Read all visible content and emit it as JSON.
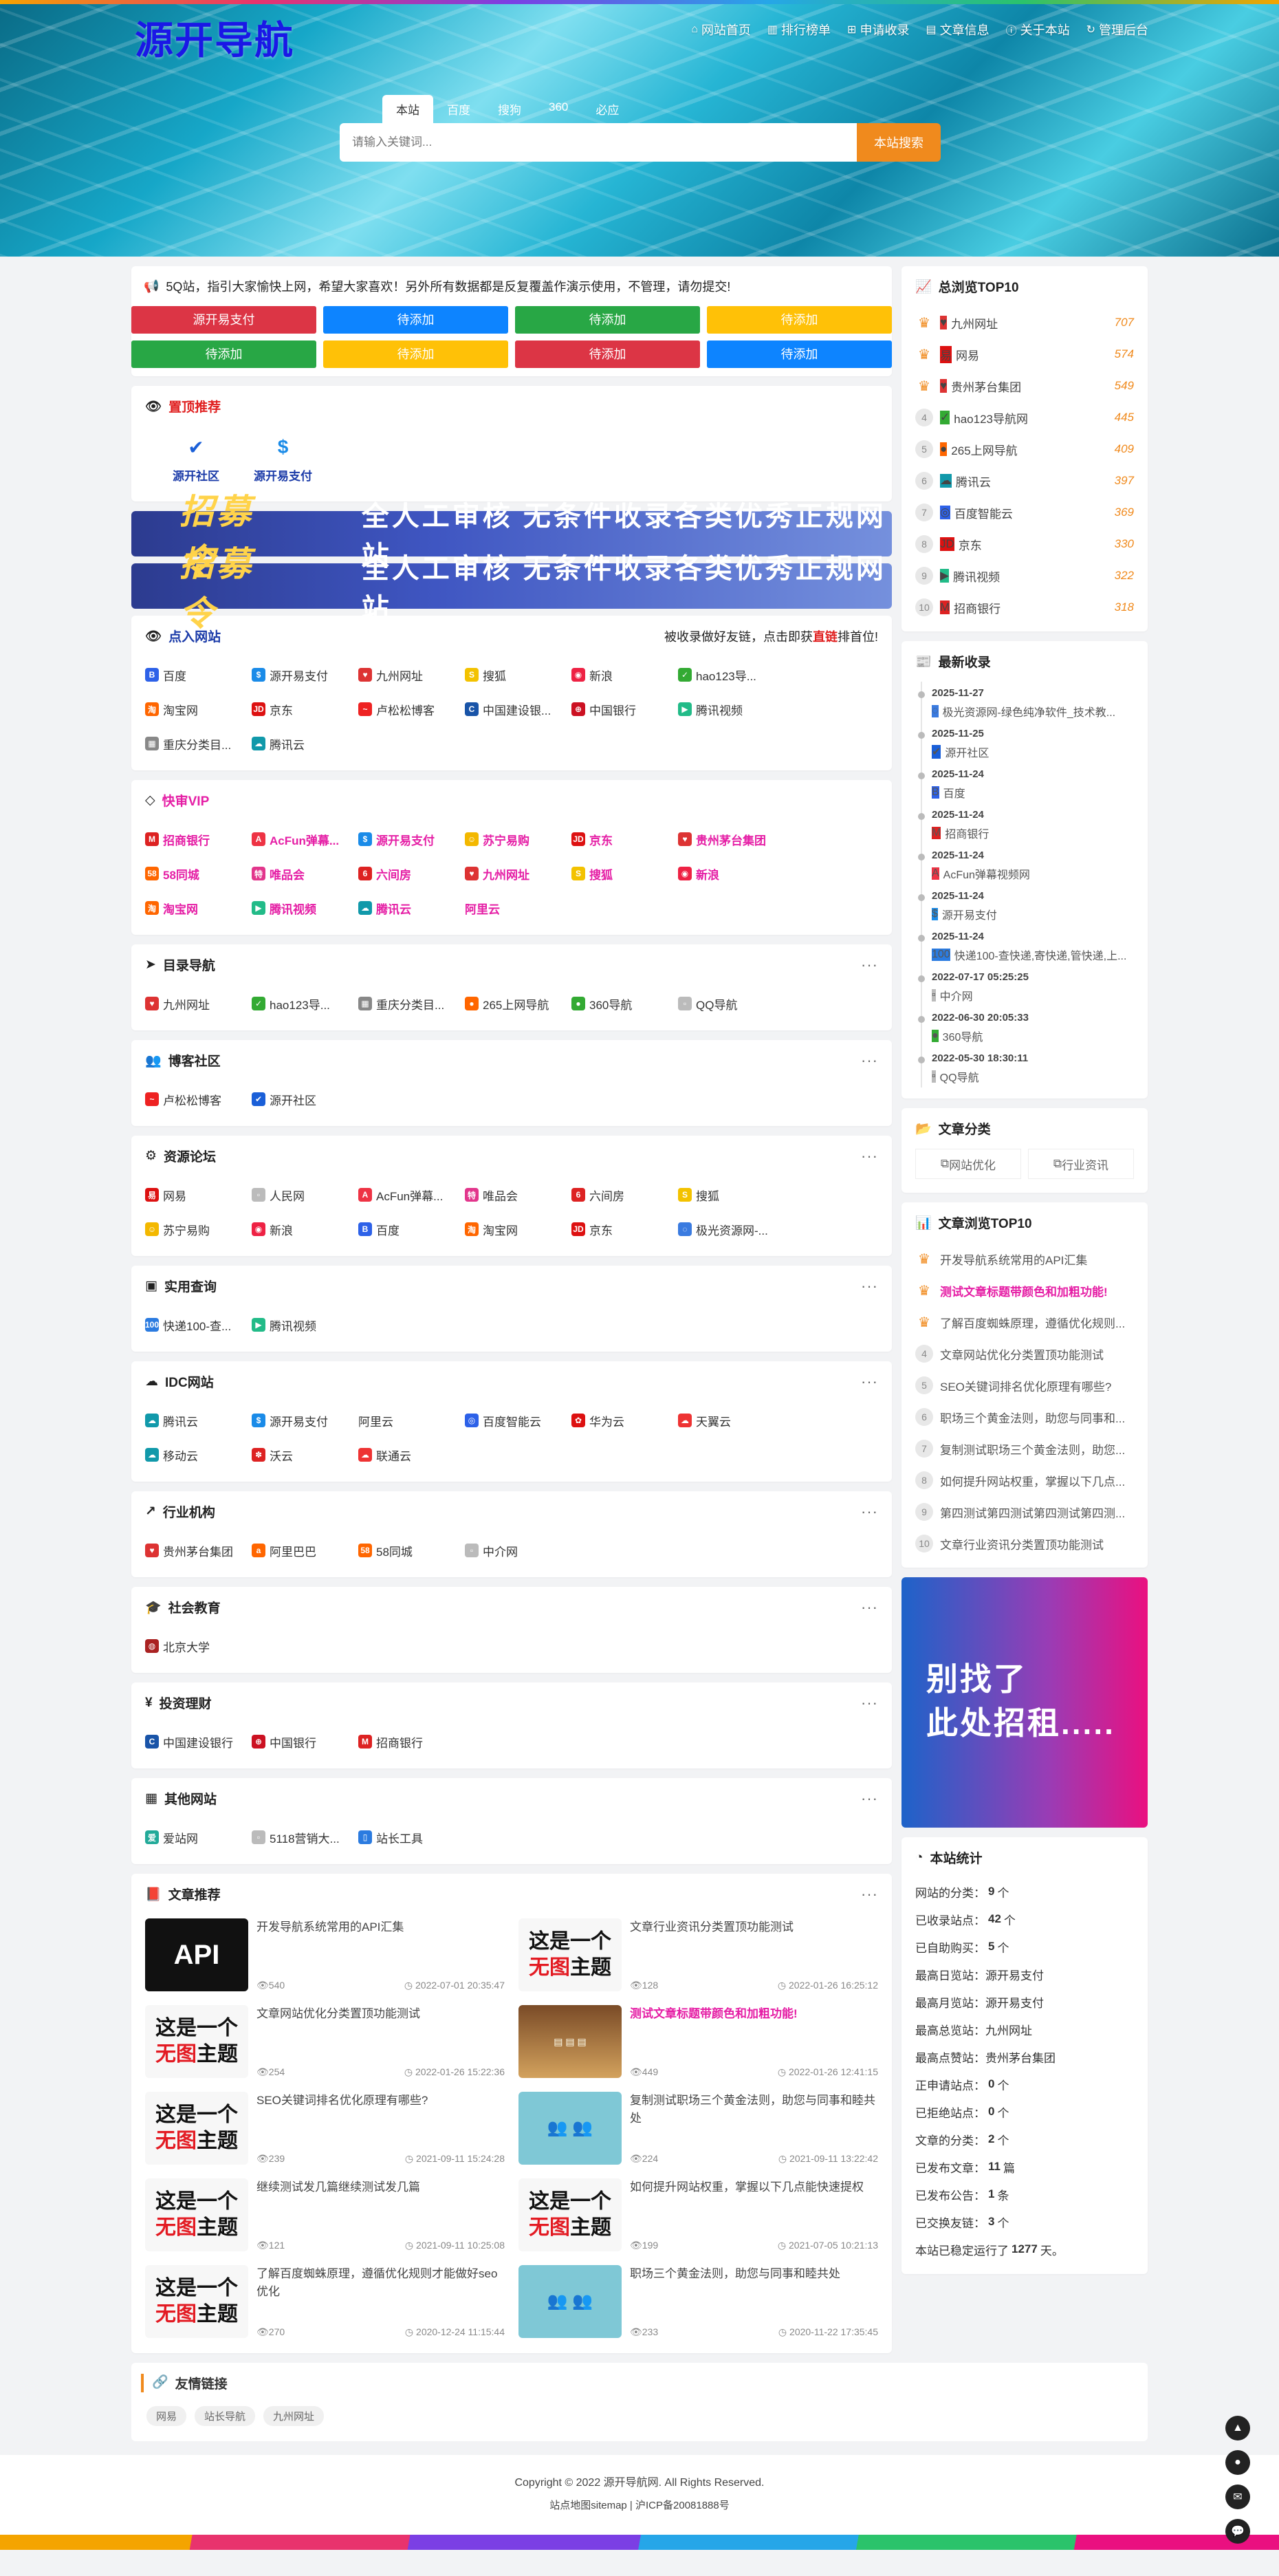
{
  "site": {
    "logo": "源开导航",
    "nav": [
      {
        "icon": "home-icon",
        "glyph": "⌂",
        "label": "网站首页"
      },
      {
        "icon": "chart-icon",
        "glyph": "▥",
        "label": "排行榜单"
      },
      {
        "icon": "plus-icon",
        "glyph": "⊞",
        "label": "申请收录"
      },
      {
        "icon": "document-icon",
        "glyph": "▤",
        "label": "文章信息"
      },
      {
        "icon": "info-icon",
        "glyph": "ⓘ",
        "label": "关于本站"
      },
      {
        "icon": "refresh-icon",
        "glyph": "↻",
        "label": "管理后台"
      }
    ]
  },
  "search": {
    "tabs": [
      "本站",
      "百度",
      "搜狗",
      "360",
      "必应"
    ],
    "placeholder": "请输入关键词...",
    "button": "本站搜索"
  },
  "notice": "5Q站，指引大家愉快上网，希望大家喜欢！另外所有数据都是反复覆盖作演示使用，不管理，请勿提交!",
  "quick_buttons": [
    {
      "label": "源开易支付",
      "color": "red"
    },
    {
      "label": "待添加",
      "color": "blue"
    },
    {
      "label": "待添加",
      "color": "green"
    },
    {
      "label": "待添加",
      "color": "yellow"
    },
    {
      "label": "待添加",
      "color": "green"
    },
    {
      "label": "待添加",
      "color": "yellow"
    },
    {
      "label": "待添加",
      "color": "red"
    },
    {
      "label": "待添加",
      "color": "blue"
    }
  ],
  "top_recommend": {
    "title": "置顶推荐",
    "items": [
      {
        "label": "源开社区",
        "glyph": "✔",
        "color": "#1a5fd8"
      },
      {
        "label": "源开易支付",
        "glyph": "$",
        "color": "#1a8be8"
      }
    ]
  },
  "banners": [
    {
      "tag": "招募令",
      "text": "全人工审核  无条件收录各类优秀正规网站"
    },
    {
      "tag": "招募令",
      "text": "全人工审核  无条件收录各类优秀正规网站"
    }
  ],
  "clicked": {
    "title": "点入网站",
    "note_pre": "被收录做好友链，点击即获",
    "note_hl": "直链",
    "note_post": "排首位!",
    "sites": [
      {
        "n": "百度",
        "g": "B",
        "c": "#2d61e8"
      },
      {
        "n": "源开易支付",
        "g": "$",
        "c": "#1a8be8"
      },
      {
        "n": "九州网址",
        "g": "♥",
        "c": "#d33"
      },
      {
        "n": "搜狐",
        "g": "S",
        "c": "#f3c200"
      },
      {
        "n": "新浪",
        "g": "◉",
        "c": "#e24"
      },
      {
        "n": "hao123导...",
        "g": "✓",
        "c": "#3a3"
      },
      {
        "n": "淘宝网",
        "g": "淘",
        "c": "#f60"
      },
      {
        "n": "京东",
        "g": "JD",
        "c": "#d11"
      },
      {
        "n": "卢松松博客",
        "g": "~",
        "c": "#e22"
      },
      {
        "n": "中国建设银...",
        "g": "C",
        "c": "#1954a8"
      },
      {
        "n": "中国银行",
        "g": "⊕",
        "c": "#c12"
      },
      {
        "n": "腾讯视频",
        "g": "▶",
        "c": "#2b8"
      },
      {
        "n": "重庆分类目...",
        "g": "▦",
        "c": "#888"
      },
      {
        "n": "腾讯云",
        "g": "☁",
        "c": "#19a"
      }
    ]
  },
  "vip": {
    "title": "快审VIP",
    "sites": [
      {
        "n": "招商银行",
        "g": "M",
        "c": "#d22"
      },
      {
        "n": "AcFun弹幕...",
        "g": "A",
        "c": "#e34"
      },
      {
        "n": "源开易支付",
        "g": "$",
        "c": "#1a8be8"
      },
      {
        "n": "苏宁易购",
        "g": "☺",
        "c": "#f3b800"
      },
      {
        "n": "京东",
        "g": "JD",
        "c": "#d11"
      },
      {
        "n": "贵州茅台集团",
        "g": "♥",
        "c": "#d33"
      },
      {
        "n": "58同城",
        "g": "58",
        "c": "#f60"
      },
      {
        "n": "唯品会",
        "g": "特",
        "c": "#e2368c"
      },
      {
        "n": "六间房",
        "g": "6",
        "c": "#d22"
      },
      {
        "n": "九州网址",
        "g": "♥",
        "c": "#d33"
      },
      {
        "n": "搜狐",
        "g": "S",
        "c": "#f3c200"
      },
      {
        "n": "新浪",
        "g": "◉",
        "c": "#e24"
      },
      {
        "n": "淘宝网",
        "g": "淘",
        "c": "#f60"
      },
      {
        "n": "腾讯视频",
        "g": "▶",
        "c": "#2b8"
      },
      {
        "n": "腾讯云",
        "g": "☁",
        "c": "#19a"
      },
      {
        "n": "阿里云",
        "g": "",
        "c": "#ffffff"
      }
    ]
  },
  "categories": [
    {
      "title": "目录导航",
      "icon": "send-icon",
      "glyph": "➤",
      "sites": [
        {
          "n": "九州网址",
          "g": "♥",
          "c": "#d33"
        },
        {
          "n": "hao123导...",
          "g": "✓",
          "c": "#3a3"
        },
        {
          "n": "重庆分类目...",
          "g": "▦",
          "c": "#888"
        },
        {
          "n": "265上网导航",
          "g": "●",
          "c": "#f60"
        },
        {
          "n": "360导航",
          "g": "●",
          "c": "#3a3"
        },
        {
          "n": "QQ导航",
          "g": "▫",
          "c": "#bbb"
        }
      ]
    },
    {
      "title": "博客社区",
      "icon": "users-icon",
      "glyph": "👥",
      "sites": [
        {
          "n": "卢松松博客",
          "g": "~",
          "c": "#e22"
        },
        {
          "n": "源开社区",
          "g": "✔",
          "c": "#1a5fd8"
        }
      ]
    },
    {
      "title": "资源论坛",
      "icon": "forum-icon",
      "glyph": "⚙",
      "sites": [
        {
          "n": "网易",
          "g": "易",
          "c": "#d11"
        },
        {
          "n": "人民网",
          "g": "▫",
          "c": "#bbb"
        },
        {
          "n": "AcFun弹幕...",
          "g": "A",
          "c": "#e34"
        },
        {
          "n": "唯品会",
          "g": "特",
          "c": "#e2368c"
        },
        {
          "n": "六间房",
          "g": "6",
          "c": "#d22"
        },
        {
          "n": "搜狐",
          "g": "S",
          "c": "#f3c200"
        },
        {
          "n": "苏宁易购",
          "g": "☺",
          "c": "#f3b800"
        },
        {
          "n": "新浪",
          "g": "◉",
          "c": "#e24"
        },
        {
          "n": "百度",
          "g": "B",
          "c": "#2d61e8"
        },
        {
          "n": "淘宝网",
          "g": "淘",
          "c": "#f60"
        },
        {
          "n": "京东",
          "g": "JD",
          "c": "#d11"
        },
        {
          "n": "极光资源网-...",
          "g": "◌",
          "c": "#3a7be0"
        }
      ]
    },
    {
      "title": "实用查询",
      "icon": "video-icon",
      "glyph": "▣",
      "sites": [
        {
          "n": "快递100-查...",
          "g": "100",
          "c": "#2b7be0"
        },
        {
          "n": "腾讯视频",
          "g": "▶",
          "c": "#2b8"
        }
      ]
    },
    {
      "title": "IDC网站",
      "icon": "cloud-icon",
      "glyph": "☁",
      "sites": [
        {
          "n": "腾讯云",
          "g": "☁",
          "c": "#19a"
        },
        {
          "n": "源开易支付",
          "g": "$",
          "c": "#1a8be8"
        },
        {
          "n": "阿里云",
          "g": "",
          "c": "#ffffff"
        },
        {
          "n": "百度智能云",
          "g": "◎",
          "c": "#2d61e8"
        },
        {
          "n": "华为云",
          "g": "✿",
          "c": "#d11"
        },
        {
          "n": "天翼云",
          "g": "☁",
          "c": "#e33"
        },
        {
          "n": "移动云",
          "g": "☁",
          "c": "#19a"
        },
        {
          "n": "沃云",
          "g": "✽",
          "c": "#d22"
        },
        {
          "n": "联通云",
          "g": "☁",
          "c": "#e33"
        }
      ]
    },
    {
      "title": "行业机构",
      "icon": "trend-icon",
      "glyph": "↗",
      "sites": [
        {
          "n": "贵州茅台集团",
          "g": "♥",
          "c": "#d33"
        },
        {
          "n": "阿里巴巴",
          "g": "a",
          "c": "#f60"
        },
        {
          "n": "58同城",
          "g": "58",
          "c": "#f60"
        },
        {
          "n": "中介网",
          "g": "▫",
          "c": "#bbb"
        }
      ]
    },
    {
      "title": "社会教育",
      "icon": "graduation-icon",
      "glyph": "🎓",
      "sites": [
        {
          "n": "北京大学",
          "g": "◍",
          "c": "#a22"
        }
      ]
    },
    {
      "title": "投资理财",
      "icon": "yen-icon",
      "glyph": "¥",
      "sites": [
        {
          "n": "中国建设银行",
          "g": "C",
          "c": "#1954a8"
        },
        {
          "n": "中国银行",
          "g": "⊕",
          "c": "#c12"
        },
        {
          "n": "招商银行",
          "g": "M",
          "c": "#d22"
        }
      ]
    },
    {
      "title": "其他网站",
      "icon": "grid-icon",
      "glyph": "▦",
      "sites": [
        {
          "n": "爱站网",
          "g": "爱",
          "c": "#2a9"
        },
        {
          "n": "5118营销大...",
          "g": "▫",
          "c": "#bbb"
        },
        {
          "n": "站长工具",
          "g": "▯",
          "c": "#2b7be0"
        }
      ]
    }
  ],
  "articles": {
    "title": "文章推荐",
    "items": [
      {
        "title": "开发导航系统常用的API汇集",
        "views": "540",
        "date": "2022-07-01 20:35:47",
        "thumb": "api",
        "hl": false
      },
      {
        "title": "文章行业资讯分类置顶功能测试",
        "views": "128",
        "date": "2022-01-26 16:25:12",
        "thumb": "noimg",
        "hl": false
      },
      {
        "title": "文章网站优化分类置顶功能测试",
        "views": "254",
        "date": "2022-01-26 15:22:36",
        "thumb": "noimg",
        "hl": false
      },
      {
        "title": "测试文章标题带颜色和加粗功能!",
        "views": "449",
        "date": "2022-01-26 12:41:15",
        "thumb": "web",
        "hl": true
      },
      {
        "title": "SEO关键词排名优化原理有哪些?",
        "views": "239",
        "date": "2021-09-11 15:24:28",
        "thumb": "noimg",
        "hl": false
      },
      {
        "title": "复制测试职场三个黄金法则，助您与同事和睦共处",
        "views": "224",
        "date": "2021-09-11 13:22:42",
        "thumb": "office",
        "hl": false
      },
      {
        "title": "继续测试发几篇继续测试发几篇",
        "views": "121",
        "date": "2021-09-11 10:25:08",
        "thumb": "noimg",
        "hl": false
      },
      {
        "title": "如何提升网站权重，掌握以下几点能快速提权",
        "views": "199",
        "date": "2021-07-05 10:21:13",
        "thumb": "noimg",
        "hl": false
      },
      {
        "title": "了解百度蜘蛛原理，遵循优化规则才能做好seo优化",
        "views": "270",
        "date": "2020-12-24 11:15:44",
        "thumb": "noimg",
        "hl": false
      },
      {
        "title": "职场三个黄金法则，助您与同事和睦共处",
        "views": "233",
        "date": "2020-11-22 17:35:45",
        "thumb": "office",
        "hl": false
      }
    ],
    "noimg_line1": "这是一个",
    "noimg_red": "无图",
    "noimg_line2": "主题",
    "api_text": "API"
  },
  "total_rank": {
    "title": "总浏览TOP10",
    "items": [
      {
        "name": "九州网址",
        "num": "707",
        "g": "♥",
        "c": "#d33"
      },
      {
        "name": "网易",
        "num": "574",
        "g": "易",
        "c": "#d11"
      },
      {
        "name": "贵州茅台集团",
        "num": "549",
        "g": "♥",
        "c": "#d33"
      },
      {
        "name": "hao123导航网",
        "num": "445",
        "g": "✓",
        "c": "#3a3"
      },
      {
        "name": "265上网导航",
        "num": "409",
        "g": "●",
        "c": "#f60"
      },
      {
        "name": "腾讯云",
        "num": "397",
        "g": "☁",
        "c": "#19a"
      },
      {
        "name": "百度智能云",
        "num": "369",
        "g": "◎",
        "c": "#2d61e8"
      },
      {
        "name": "京东",
        "num": "330",
        "g": "JD",
        "c": "#d11"
      },
      {
        "name": "腾讯视频",
        "num": "322",
        "g": "▶",
        "c": "#2b8"
      },
      {
        "name": "招商银行",
        "num": "318",
        "g": "M",
        "c": "#d22"
      }
    ]
  },
  "latest": {
    "title": "最新收录",
    "items": [
      {
        "date": "2025-11-27",
        "name": "极光资源网-绿色纯净软件_技术教...",
        "g": "◌",
        "c": "#3a7be0"
      },
      {
        "date": "2025-11-25",
        "name": "源开社区",
        "g": "✔",
        "c": "#1a5fd8"
      },
      {
        "date": "2025-11-24",
        "name": "百度",
        "g": "B",
        "c": "#2d61e8"
      },
      {
        "date": "2025-11-24",
        "name": "招商银行",
        "g": "M",
        "c": "#d22"
      },
      {
        "date": "2025-11-24",
        "name": "AcFun弹幕视频网",
        "g": "A",
        "c": "#e34"
      },
      {
        "date": "2025-11-24",
        "name": "源开易支付",
        "g": "$",
        "c": "#1a8be8"
      },
      {
        "date": "2025-11-24",
        "name": "快递100-查快递,寄快递,管快递,上...",
        "g": "100",
        "c": "#2b7be0"
      },
      {
        "date": "2022-07-17 05:25:25",
        "name": "中介网",
        "g": "▫",
        "c": "#bbb"
      },
      {
        "date": "2022-06-30 20:05:33",
        "name": "360导航",
        "g": "●",
        "c": "#3a3"
      },
      {
        "date": "2022-05-30 18:30:11",
        "name": "QQ导航",
        "g": "▫",
        "c": "#bbb"
      }
    ]
  },
  "article_categories": {
    "title": "文章分类",
    "items": [
      "网站优化",
      "行业资讯"
    ]
  },
  "article_rank": {
    "title": "文章浏览TOP10",
    "items": [
      {
        "name": "开发导航系统常用的API汇集",
        "hl": false
      },
      {
        "name": "测试文章标题带颜色和加粗功能!",
        "hl": true
      },
      {
        "name": "了解百度蜘蛛原理，遵循优化规则...",
        "hl": false
      },
      {
        "name": "文章网站优化分类置顶功能测试",
        "hl": false
      },
      {
        "name": "SEO关键词排名优化原理有哪些?",
        "hl": false
      },
      {
        "name": "职场三个黄金法则，助您与同事和...",
        "hl": false
      },
      {
        "name": "复制测试职场三个黄金法则，助您...",
        "hl": false
      },
      {
        "name": "如何提升网站权重，掌握以下几点...",
        "hl": false
      },
      {
        "name": "第四测试第四测试第四测试第四测...",
        "hl": false
      },
      {
        "name": "文章行业资讯分类置顶功能测试",
        "hl": false
      }
    ]
  },
  "ad": {
    "line1": "别找了",
    "line2": "此处招租....."
  },
  "stats": {
    "title": "本站统计",
    "rows": [
      {
        "k": "网站的分类：",
        "v": "9",
        "u": "个"
      },
      {
        "k": "已收录站点：",
        "v": "42",
        "u": "个"
      },
      {
        "k": "已自助购买：",
        "v": "5",
        "u": "个"
      },
      {
        "k": "最高日览站：",
        "v": "",
        "u": "源开易支付"
      },
      {
        "k": "最高月览站：",
        "v": "",
        "u": "源开易支付"
      },
      {
        "k": "最高总览站：",
        "v": "",
        "u": "九州网址"
      },
      {
        "k": "最高点赞站：",
        "v": "",
        "u": "贵州茅台集团"
      },
      {
        "k": "正申请站点：",
        "v": "0",
        "u": "个"
      },
      {
        "k": "已拒绝站点：",
        "v": "0",
        "u": "个"
      },
      {
        "k": "文章的分类：",
        "v": "2",
        "u": "个"
      },
      {
        "k": "已发布文章：",
        "v": "11",
        "u": "篇"
      },
      {
        "k": "已发布公告：",
        "v": "1",
        "u": "条"
      },
      {
        "k": "已交换友链：",
        "v": "3",
        "u": "个"
      },
      {
        "k": "本站已稳定运行了",
        "v": "1277",
        "u": "天。"
      }
    ]
  },
  "friends": {
    "title": "友情链接",
    "items": [
      "网易",
      "站长导航",
      "九州网址"
    ]
  },
  "footer": {
    "copyright": "Copyright © 2022 源开导航网. All Rights Reserved.",
    "sitemap": "站点地图sitemap",
    "sep": " | ",
    "icp": "沪ICP备20081888号"
  },
  "floats": [
    {
      "icon": "arrow-up-icon",
      "g": "▲"
    },
    {
      "icon": "notification-icon",
      "g": "●"
    },
    {
      "icon": "mail-icon",
      "g": "✉"
    },
    {
      "icon": "chat-icon",
      "g": "💬"
    }
  ]
}
